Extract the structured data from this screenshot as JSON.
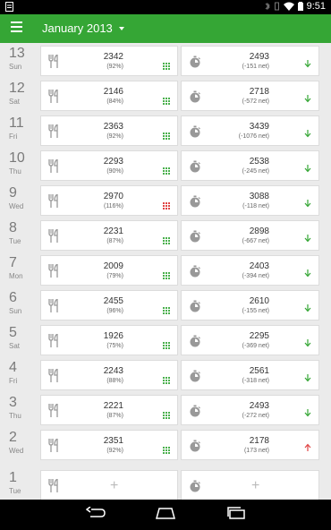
{
  "status_bar": {
    "time": "9:51"
  },
  "header": {
    "title": "January 2013"
  },
  "colors": {
    "accent": "#35a635",
    "grid_good": "#49b04c",
    "grid_bad": "#e04444",
    "arrow_down": "#35a635",
    "arrow_up": "#e04444"
  },
  "days": [
    {
      "num": "13",
      "dow": "Sun",
      "food": "2342",
      "food_pct": "(92%)",
      "food_status": "good",
      "ex": "2493",
      "ex_net": "(-151 net)",
      "dir": "down"
    },
    {
      "num": "12",
      "dow": "Sat",
      "food": "2146",
      "food_pct": "(84%)",
      "food_status": "good",
      "ex": "2718",
      "ex_net": "(-572 net)",
      "dir": "down"
    },
    {
      "num": "11",
      "dow": "Fri",
      "food": "2363",
      "food_pct": "(92%)",
      "food_status": "good",
      "ex": "3439",
      "ex_net": "(-1076 net)",
      "dir": "down"
    },
    {
      "num": "10",
      "dow": "Thu",
      "food": "2293",
      "food_pct": "(90%)",
      "food_status": "good",
      "ex": "2538",
      "ex_net": "(-245 net)",
      "dir": "down"
    },
    {
      "num": "9",
      "dow": "Wed",
      "food": "2970",
      "food_pct": "(116%)",
      "food_status": "bad",
      "ex": "3088",
      "ex_net": "(-118 net)",
      "dir": "down"
    },
    {
      "num": "8",
      "dow": "Tue",
      "food": "2231",
      "food_pct": "(87%)",
      "food_status": "good",
      "ex": "2898",
      "ex_net": "(-667 net)",
      "dir": "down"
    },
    {
      "num": "7",
      "dow": "Mon",
      "food": "2009",
      "food_pct": "(79%)",
      "food_status": "good",
      "ex": "2403",
      "ex_net": "(-394 net)",
      "dir": "down"
    },
    {
      "num": "6",
      "dow": "Sun",
      "food": "2455",
      "food_pct": "(96%)",
      "food_status": "good",
      "ex": "2610",
      "ex_net": "(-155 net)",
      "dir": "down"
    },
    {
      "num": "5",
      "dow": "Sat",
      "food": "1926",
      "food_pct": "(75%)",
      "food_status": "good",
      "ex": "2295",
      "ex_net": "(-369 net)",
      "dir": "down"
    },
    {
      "num": "4",
      "dow": "Fri",
      "food": "2243",
      "food_pct": "(88%)",
      "food_status": "good",
      "ex": "2561",
      "ex_net": "(-318 net)",
      "dir": "down"
    },
    {
      "num": "3",
      "dow": "Thu",
      "food": "2221",
      "food_pct": "(87%)",
      "food_status": "good",
      "ex": "2493",
      "ex_net": "(-272 net)",
      "dir": "down"
    },
    {
      "num": "2",
      "dow": "Wed",
      "food": "2351",
      "food_pct": "(92%)",
      "food_status": "good",
      "ex": "2178",
      "ex_net": "(173 net)",
      "dir": "up"
    },
    {
      "num": "1",
      "dow": "Tue",
      "empty": true
    }
  ],
  "icons": {
    "food": "fork-knife-icon",
    "exercise": "stopwatch-icon",
    "grid": "grid-icon",
    "arrow": "arrow-icon",
    "add": "plus-icon"
  },
  "add_label": "+"
}
